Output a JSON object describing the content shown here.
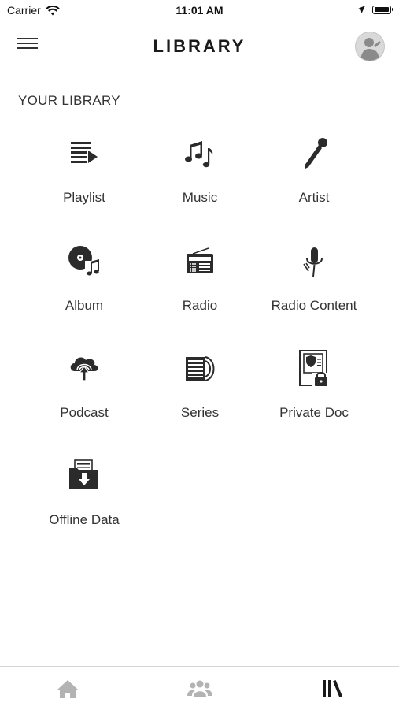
{
  "status_bar": {
    "carrier": "Carrier",
    "time": "11:01 AM",
    "icons": [
      "wifi-icon",
      "location-arrow-icon",
      "battery-icon"
    ]
  },
  "header": {
    "title": "LIBRARY",
    "menu_icon": "hamburger-menu-icon",
    "avatar_icon": "user-avatar"
  },
  "library": {
    "section_label": "YOUR LIBRARY",
    "items": [
      {
        "label": "Playlist",
        "icon": "playlist-icon"
      },
      {
        "label": "Music",
        "icon": "music-notes-icon"
      },
      {
        "label": "Artist",
        "icon": "microphone-icon"
      },
      {
        "label": "Album",
        "icon": "album-disc-icon"
      },
      {
        "label": "Radio",
        "icon": "radio-icon"
      },
      {
        "label": "Radio Content",
        "icon": "studio-mic-icon"
      },
      {
        "label": "Podcast",
        "icon": "podcast-cloud-icon"
      },
      {
        "label": "Series",
        "icon": "series-icon"
      },
      {
        "label": "Private Doc",
        "icon": "private-doc-icon"
      },
      {
        "label": "Offline Data",
        "icon": "offline-folder-icon"
      }
    ]
  },
  "tab_bar": {
    "tabs": [
      {
        "name": "home",
        "icon": "home-icon",
        "active": false
      },
      {
        "name": "community",
        "icon": "group-icon",
        "active": false
      },
      {
        "name": "library",
        "icon": "library-icon",
        "active": true
      }
    ],
    "colors": {
      "active": "#1a1a1a",
      "inactive": "#b3b3b3"
    }
  }
}
